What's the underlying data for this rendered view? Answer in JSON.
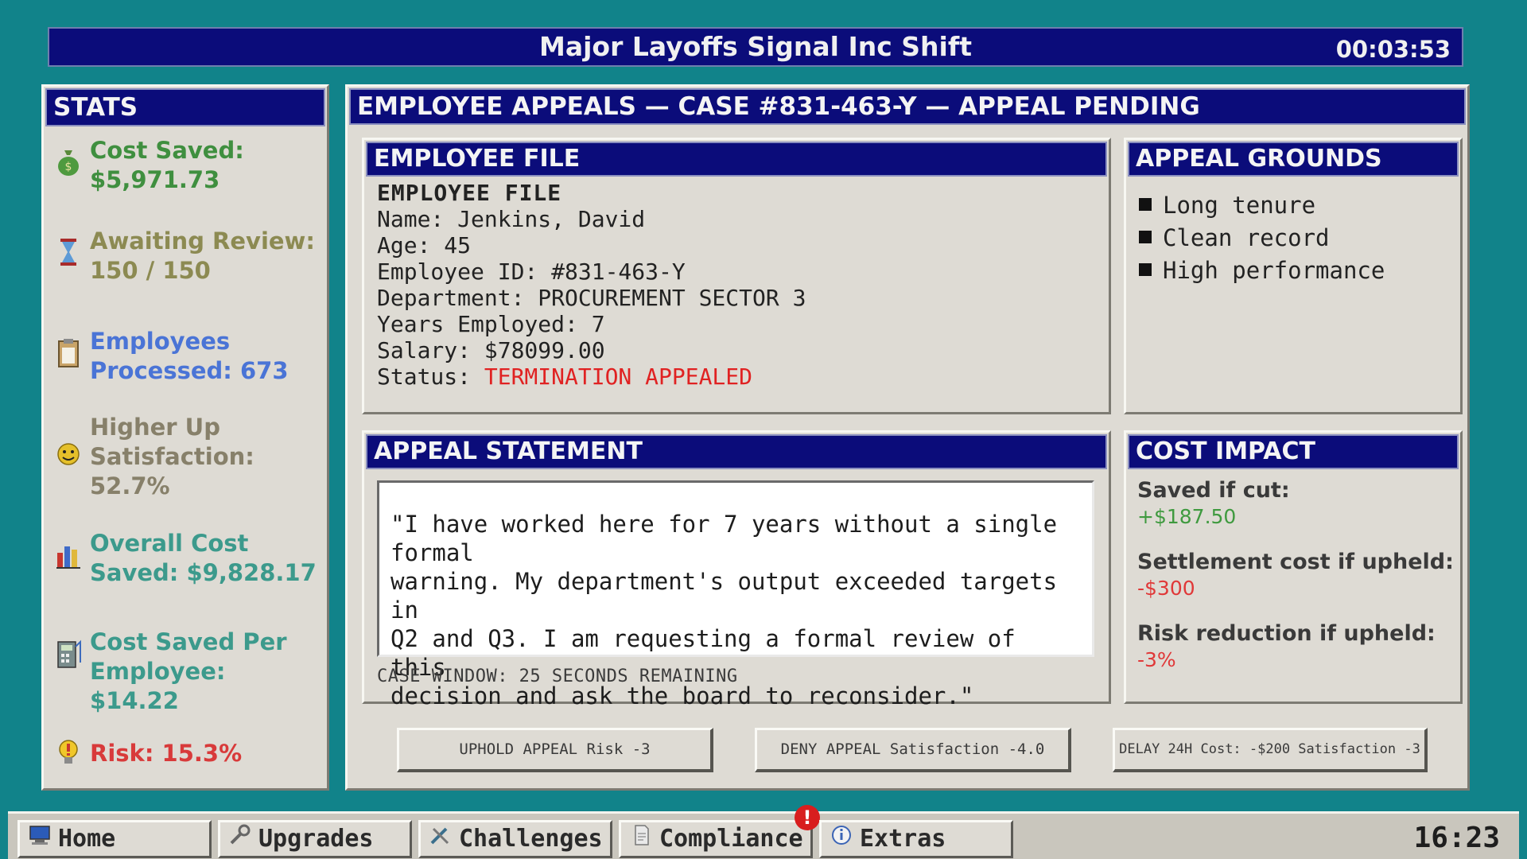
{
  "window": {
    "title": "Major Layoffs Signal Inc Shift",
    "timer": "00:03:53"
  },
  "stats": {
    "heading": "STATS",
    "items": [
      {
        "icon": "money-bag-icon",
        "label": "Cost Saved:",
        "value": "$5,971.73",
        "color": "#3f8f3f"
      },
      {
        "icon": "hourglass-icon",
        "label": "Awaiting Review:",
        "value": "150 / 150",
        "color": "#8c8a52"
      },
      {
        "icon": "clipboard-icon",
        "label": "Employees Processed:",
        "value": "673",
        "color": "#4a74d6"
      },
      {
        "icon": "smiley-icon",
        "label": "Higher Up Satisfaction:",
        "value": "52.7%",
        "color": "#87806a"
      },
      {
        "icon": "bar-chart-icon",
        "label": "Overall Cost Saved:",
        "value": "$9,828.17",
        "color": "#3c9a8c"
      },
      {
        "icon": "calculator-icon",
        "label": "Cost Saved Per Employee:",
        "value": "$14.22",
        "color": "#3c9a8c"
      },
      {
        "icon": "warning-bulb-icon",
        "label": "Risk:",
        "value": "15.3%",
        "color": "#d83a3a"
      }
    ],
    "lines": {
      "cost_saved_1": "Cost Saved:",
      "cost_saved_2": "$5,971.73",
      "awaiting_1": "Awaiting Review:",
      "awaiting_2": "150 / 150",
      "processed_1": "Employees",
      "processed_2": "Processed: 673",
      "satisfaction_1": "Higher Up",
      "satisfaction_2": "Satisfaction:",
      "satisfaction_3": "52.7%",
      "overall_1": "Overall Cost",
      "overall_2": "Saved: $9,828.17",
      "per_emp_1": "Cost Saved Per",
      "per_emp_2": "Employee: $14.22",
      "risk": "Risk: 15.3%"
    }
  },
  "appeals": {
    "heading": "EMPLOYEE APPEALS — CASE #831-463-Y — APPEAL PENDING",
    "employee_file": {
      "heading": "EMPLOYEE FILE",
      "inner_heading": "EMPLOYEE FILE",
      "name": "Name: Jenkins, David",
      "age": "Age: 45",
      "employee_id": "Employee ID: #831-463-Y",
      "department": "Department: PROCUREMENT SECTOR 3",
      "years": "Years Employed: 7",
      "salary": "Salary: $78099.00",
      "status_label": "Status: ",
      "status_value": "TERMINATION APPEALED"
    },
    "grounds": {
      "heading": "APPEAL GROUNDS",
      "items": [
        "Long tenure",
        "Clean record",
        "High performance"
      ]
    },
    "statement": {
      "heading": "APPEAL STATEMENT",
      "line1": "\"I have worked here for 7 years without a single formal",
      "line2": "warning. My department's output exceeded targets in",
      "line3": "Q2 and Q3. I am requesting a formal review of this",
      "line4": "decision and ask the board to reconsider.\"",
      "case_window": "CASE WINDOW: 25 SECONDS REMAINING"
    },
    "cost_impact": {
      "heading": "COST IMPACT",
      "saved_label": "Saved if cut:",
      "saved_value": "+$187.50",
      "settlement_label": "Settlement cost if upheld:",
      "settlement_value": "-$300",
      "risk_label": "Risk reduction if upheld:",
      "risk_value": "-3%"
    },
    "actions": {
      "uphold": "UPHOLD APPEAL Risk -3",
      "deny": "DENY APPEAL Satisfaction -4.0",
      "delay": "DELAY 24H Cost: -$200 Satisfaction -3"
    }
  },
  "taskbar": {
    "items": [
      {
        "label": "Home",
        "icon": "computer-icon"
      },
      {
        "label": "Upgrades",
        "icon": "wrench-icon"
      },
      {
        "label": "Challenges",
        "icon": "tools-icon"
      },
      {
        "label": "Compliance",
        "icon": "document-icon",
        "badge": "!"
      },
      {
        "label": "Extras",
        "icon": "info-icon"
      }
    ],
    "clock": "16:23"
  }
}
